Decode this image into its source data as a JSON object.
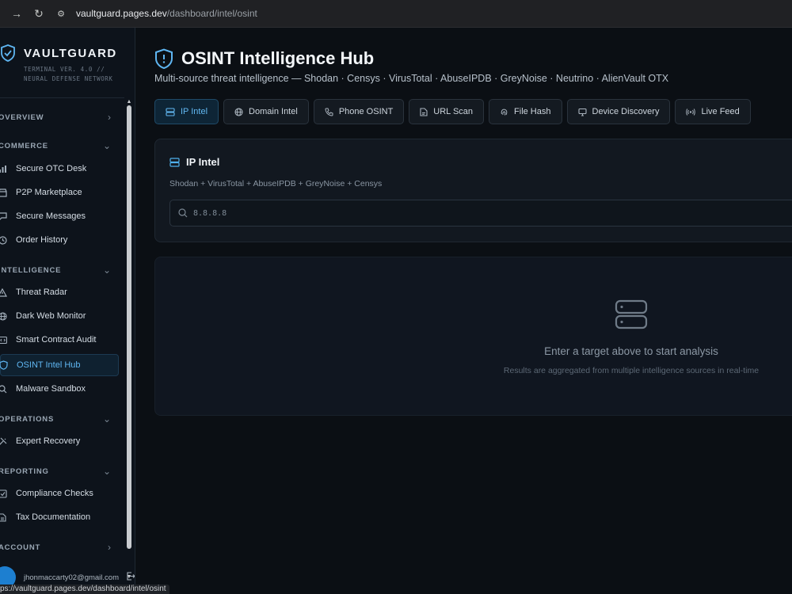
{
  "browser": {
    "url_host": "vaultguard.pages.dev",
    "url_path": "/dashboard/intel/osint",
    "status_url": "ps://vaultguard.pages.dev/dashboard/intel/osint"
  },
  "brand": {
    "name": "VAULTGUARD",
    "tagline": "TERMINAL VER. 4.0 // NEURAL DEFENSE NETWORK"
  },
  "sidebar": {
    "sections": [
      {
        "label": "OVERVIEW",
        "expanded": false
      },
      {
        "label": "COMMERCE",
        "expanded": true,
        "items": [
          "Secure OTC Desk",
          "P2P Marketplace",
          "Secure Messages",
          "Order History"
        ]
      },
      {
        "label": "INTELLIGENCE",
        "expanded": true,
        "items": [
          "Threat Radar",
          "Dark Web Monitor",
          "Smart Contract Audit",
          "OSINT Intel Hub",
          "Malware Sandbox"
        ]
      },
      {
        "label": "OPERATIONS",
        "expanded": true,
        "items": [
          "Expert Recovery"
        ]
      },
      {
        "label": "REPORTING",
        "expanded": true,
        "items": [
          "Compliance Checks",
          "Tax Documentation"
        ]
      },
      {
        "label": "ACCOUNT",
        "expanded": false
      }
    ],
    "active_item": "OSINT Intel Hub",
    "user_email": "jhonmaccarty02@gmail.com"
  },
  "main": {
    "title": "OSINT Intelligence Hub",
    "subtitle": "Multi-source threat intelligence — Shodan · Censys · VirusTotal · AbuseIPDB · GreyNoise · Neutrino · AlienVault OTX",
    "tabs": [
      {
        "label": "IP Intel",
        "icon": "server-icon",
        "active": true
      },
      {
        "label": "Domain Intel",
        "icon": "globe-icon",
        "active": false
      },
      {
        "label": "Phone OSINT",
        "icon": "phone-icon",
        "active": false
      },
      {
        "label": "URL Scan",
        "icon": "document-icon",
        "active": false
      },
      {
        "label": "File Hash",
        "icon": "fingerprint-icon",
        "active": false
      },
      {
        "label": "Device Discovery",
        "icon": "monitor-icon",
        "active": false
      },
      {
        "label": "Live Feed",
        "icon": "radio-icon",
        "active": false
      }
    ],
    "panel": {
      "title": "IP Intel",
      "sources": "Shodan + VirusTotal + AbuseIPDB + GreyNoise + Censys",
      "search_placeholder": "8.8.8.8"
    },
    "empty_state": {
      "title": "Enter a target above to start analysis",
      "subtitle": "Results are aggregated from multiple intelligence sources in real-time"
    }
  },
  "colors": {
    "accent": "#5fb6f2",
    "background": "#0b0f14",
    "sidebar": "#0d131b",
    "panel": "#121820"
  }
}
